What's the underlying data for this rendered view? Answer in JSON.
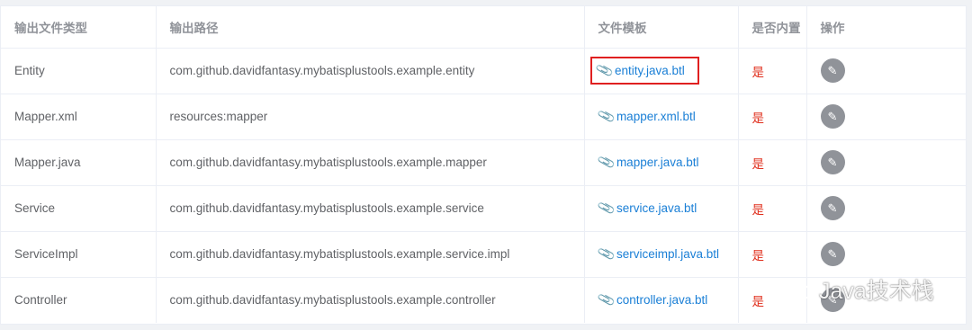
{
  "columns": [
    "输出文件类型",
    "输出路径",
    "文件模板",
    "是否内置",
    "操作"
  ],
  "rows": [
    {
      "type": "Entity",
      "path": "com.github.davidfantasy.mybatisplustools.example.entity",
      "template": "entity.java.btl",
      "builtin": "是"
    },
    {
      "type": "Mapper.xml",
      "path": "resources:mapper",
      "template": "mapper.xml.btl",
      "builtin": "是"
    },
    {
      "type": "Mapper.java",
      "path": "com.github.davidfantasy.mybatisplustools.example.mapper",
      "template": "mapper.java.btl",
      "builtin": "是"
    },
    {
      "type": "Service",
      "path": "com.github.davidfantasy.mybatisplustools.example.service",
      "template": "service.java.btl",
      "builtin": "是"
    },
    {
      "type": "ServiceImpl",
      "path": "com.github.davidfantasy.mybatisplustools.example.service.impl",
      "template": "serviceimpl.java.btl",
      "builtin": "是"
    },
    {
      "type": "Controller",
      "path": "com.github.davidfantasy.mybatisplustools.example.controller",
      "template": "controller.java.btl",
      "builtin": "是"
    }
  ],
  "icons": {
    "template": "paperclip-icon",
    "action": "edit-pencil-icon",
    "watermark": "wechat-icon"
  },
  "watermark": {
    "text": "Java技术栈"
  },
  "colors": {
    "link": "#1a7fd6",
    "builtin": "#e0301e",
    "highlight": "#e02020",
    "button": "#909399"
  }
}
